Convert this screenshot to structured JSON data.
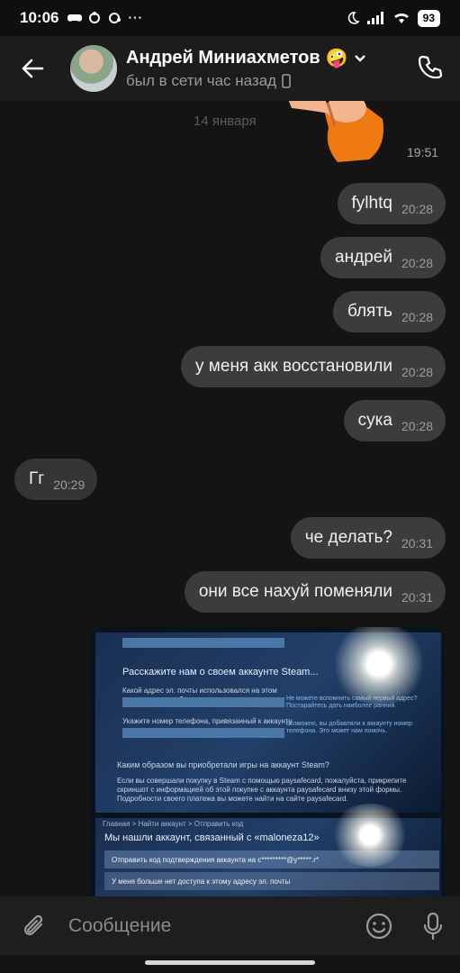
{
  "status_bar": {
    "time": "10:06",
    "battery": "93"
  },
  "header": {
    "contact_name": "Андрей Миниахметов",
    "emoji": "🤪",
    "status": "был в сети час назад"
  },
  "chat": {
    "date_separator": "14 января",
    "sticker_time": "19:51",
    "messages": [
      {
        "direction": "out",
        "text": "fylhtq",
        "time": "20:28"
      },
      {
        "direction": "out",
        "text": "андрей",
        "time": "20:28"
      },
      {
        "direction": "out",
        "text": "блять",
        "time": "20:28"
      },
      {
        "direction": "out",
        "text": "у меня акк восстановили",
        "time": "20:28"
      },
      {
        "direction": "out",
        "text": "сука",
        "time": "20:28"
      },
      {
        "direction": "in",
        "text": "Гг",
        "time": "20:29"
      },
      {
        "direction": "out",
        "text": "че делать?",
        "time": "20:31"
      },
      {
        "direction": "out",
        "text": "они все нахуй поменяли",
        "time": "20:31"
      }
    ],
    "photo": {
      "shot1": {
        "heading": "Расскажите нам о своем аккаунте Steam...",
        "q1": "Какой адрес эл. почты использовался на этом аккаунте первым?",
        "hint1": "Не можете вспомнить самый первый адрес? Постарайтесь дать наиболее ранний.",
        "q2": "Укажите номер телефона, привязанный к аккаунту",
        "hint2": "Возможно, вы добавляли к аккаунту номер телефона. Это может нам помочь.",
        "heading2": "Каким образом вы приобретали игры на аккаунт Steam?",
        "body": "Если вы совершали покупку в Steam с помощью paysafecard, пожалуйста, прикрепите скриншот с информацией об этой покупке с аккаунта paysafecard внизу этой формы. Подробности своего платежа вы можете найти на сайте paysafecard."
      },
      "shot2": {
        "breadcrumb": "Главная > Найти аккаунт > Отправить код",
        "heading": "Мы нашли аккаунт, связанный с «maloneza12»",
        "option1": "Отправить код подтверждения аккаунта на с*********@y*****.r*",
        "option2": "У меня больше нет доступа к этому адресу эл. почты"
      }
    }
  },
  "input": {
    "placeholder": "Сообщение"
  }
}
